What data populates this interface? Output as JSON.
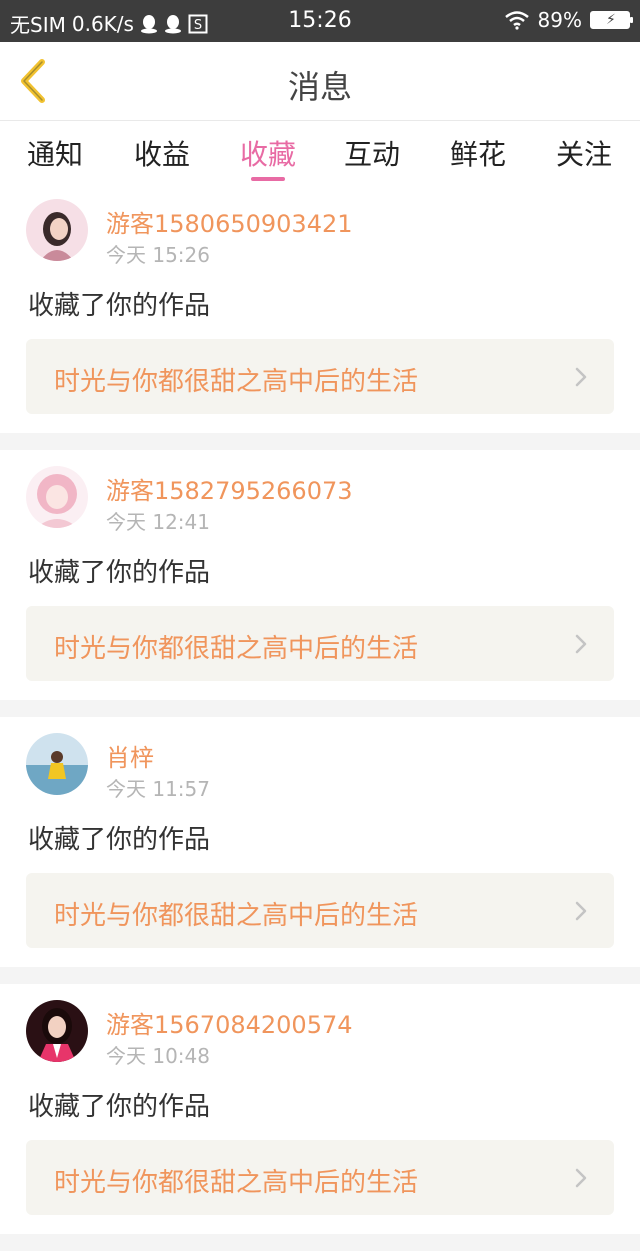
{
  "status_bar": {
    "carrier": "无SIM",
    "speed": "0.6K/s",
    "time": "15:26",
    "battery": "89%"
  },
  "nav": {
    "title": "消息"
  },
  "tabs": [
    {
      "label": "通知"
    },
    {
      "label": "收益"
    },
    {
      "label": "收藏",
      "active": true
    },
    {
      "label": "互动"
    },
    {
      "label": "鲜花"
    },
    {
      "label": "关注"
    }
  ],
  "messages": [
    {
      "user": "游客1580650903421",
      "time": "今天 15:26",
      "action": "收藏了你的作品",
      "work": "时光与你都很甜之高中后的生活"
    },
    {
      "user": "游客1582795266073",
      "time": "今天 12:41",
      "action": "收藏了你的作品",
      "work": "时光与你都很甜之高中后的生活"
    },
    {
      "user": "肖梓",
      "time": "今天 11:57",
      "action": "收藏了你的作品",
      "work": "时光与你都很甜之高中后的生活"
    },
    {
      "user": "游客1567084200574",
      "time": "今天 10:48",
      "action": "收藏了你的作品",
      "work": "时光与你都很甜之高中后的生活"
    }
  ],
  "colors": {
    "accent_pink": "#e86ba4",
    "name_orange": "#f0955c",
    "back_yellow": "#f2c230"
  }
}
